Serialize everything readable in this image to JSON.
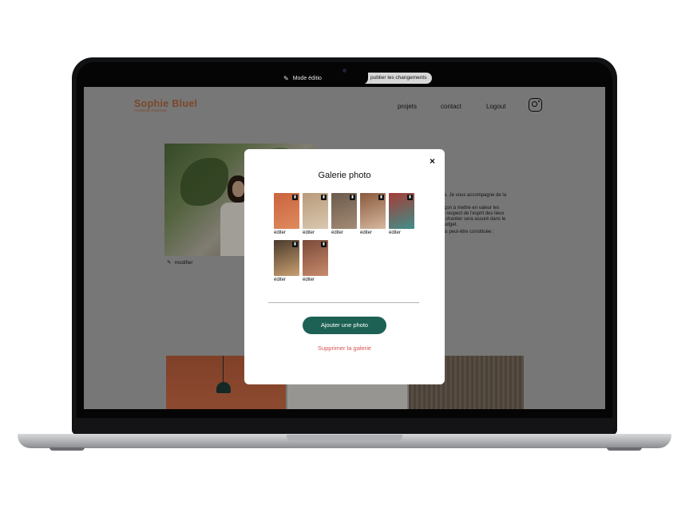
{
  "topbar": {
    "edit_icon": "pen-square-icon",
    "mode_label": "Mode édition",
    "publish_label": "publier les changements"
  },
  "site": {
    "brand_name": "Sophie Bluel",
    "brand_sub": "Architecte d'intérieur",
    "nav": [
      "projets",
      "contact",
      "Logout"
    ],
    "instagram_icon": "instagram-icon",
    "modifier_label": "modifier",
    "intro_text": [
      "",
      "es. Je vous accompagne de la",
      "",
      "açon à mettre en valeur les",
      "le respect de l'esprit des lieux",
      "u chantier sera assuré dans le",
      "budget.",
      "uis peut-être constituée :"
    ]
  },
  "modal": {
    "title": "Galerie photo",
    "close_label": "×",
    "thumbnails": [
      {
        "label": "éditer",
        "color_a": "#c9643e",
        "color_b": "#e08a5e"
      },
      {
        "label": "éditer",
        "color_a": "#b89a7a",
        "color_b": "#d9c9b0"
      },
      {
        "label": "éditer",
        "color_a": "#6b5a4c",
        "color_b": "#a48c76"
      },
      {
        "label": "éditer",
        "color_a": "#8a5a3c",
        "color_b": "#d6b8a0"
      },
      {
        "label": "éditer",
        "color_a": "#a63c36",
        "color_b": "#3f8f8a"
      },
      {
        "label": "éditer",
        "color_a": "#4a3a2c",
        "color_b": "#c9a070"
      },
      {
        "label": "éditer",
        "color_a": "#7a4a3a",
        "color_b": "#c98a6a"
      }
    ],
    "add_photo_label": "Ajouter une photo",
    "delete_gallery_label": "Supprimer la galerie"
  },
  "colors": {
    "brand": "#b1663c",
    "primary_button": "#1d6154",
    "danger": "#d65353"
  }
}
